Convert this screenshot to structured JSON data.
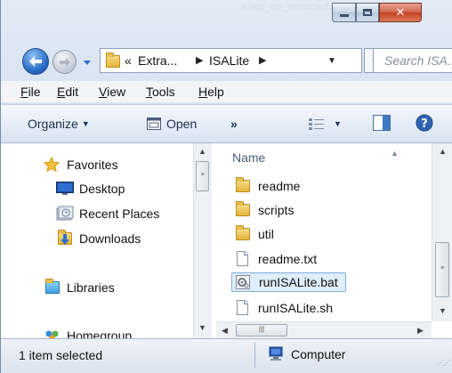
{
  "window": {
    "ghost_title": "e:\\isa_lite_extracted\\isalite",
    "controls": {
      "minimize": "minimize",
      "maximize": "maximize",
      "close": "close"
    }
  },
  "address": {
    "overflow": "«",
    "crumbs": [
      "Extra...",
      "ISALite"
    ]
  },
  "search": {
    "placeholder": "Search ISA..."
  },
  "menu": [
    {
      "key": "F",
      "rest": "ile"
    },
    {
      "key": "E",
      "rest": "dit"
    },
    {
      "key": "V",
      "rest": "iew"
    },
    {
      "key": "T",
      "rest": "ools"
    },
    {
      "key": "H",
      "rest": "elp"
    }
  ],
  "toolbar": {
    "organize": "Organize",
    "open": "Open",
    "more": "»"
  },
  "nav_pane": {
    "favorites": "Favorites",
    "desktop": "Desktop",
    "recent": "Recent Places",
    "downloads": "Downloads",
    "libraries": "Libraries",
    "homegroup": "Homegroup"
  },
  "file_pane": {
    "column_name": "Name",
    "files": [
      {
        "name": "readme",
        "type": "folder"
      },
      {
        "name": "scripts",
        "type": "folder"
      },
      {
        "name": "util",
        "type": "folder"
      },
      {
        "name": "readme.txt",
        "type": "text"
      },
      {
        "name": "runISALite.bat",
        "type": "batch",
        "selected": true
      },
      {
        "name": "runISALite.sh",
        "type": "text"
      }
    ]
  },
  "status": {
    "selection": "1 item selected",
    "location": "Computer"
  },
  "colors": {
    "selection_bg": "#dfeefb",
    "selection_border": "#84acdd",
    "folder": "#e4b33b",
    "accent_blue": "#2c6fc8"
  }
}
